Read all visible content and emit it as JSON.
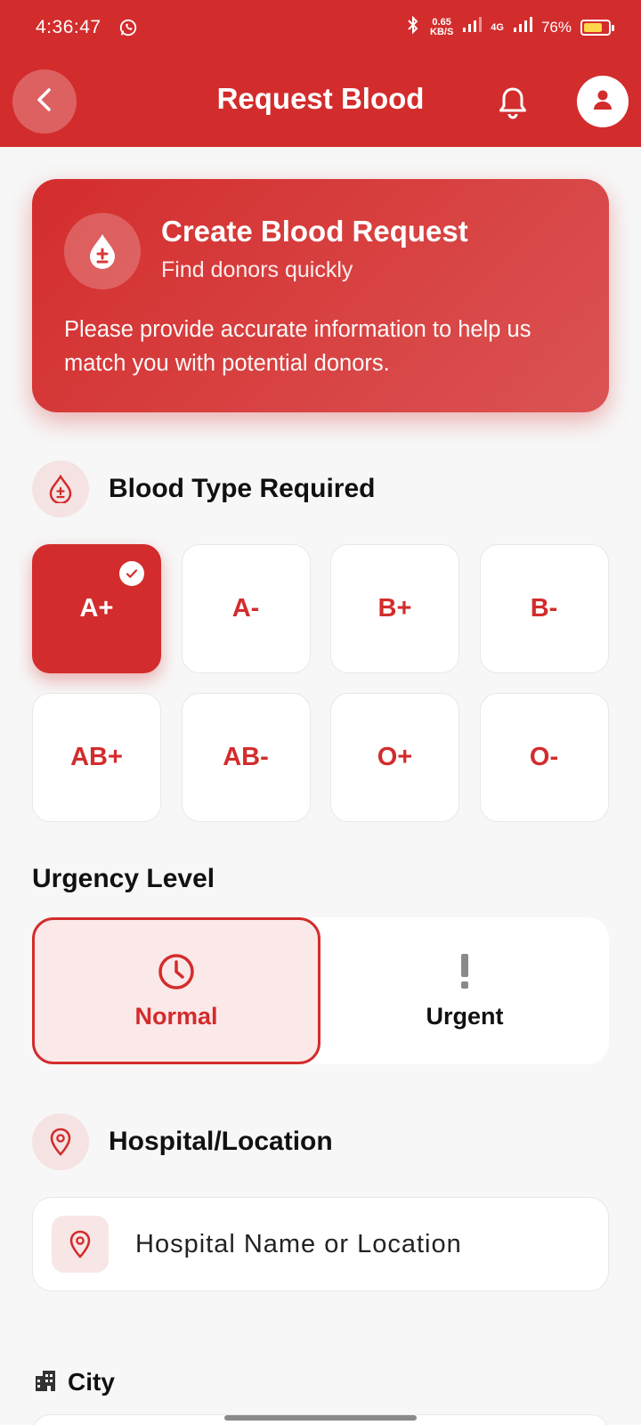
{
  "status_bar": {
    "time": "4:36:47",
    "speed_value": "0.65",
    "speed_unit": "KB/S",
    "network": "4G",
    "battery": "76%"
  },
  "header": {
    "title": "Request Blood"
  },
  "hero": {
    "title": "Create Blood Request",
    "subtitle": "Find donors quickly",
    "description": "Please provide accurate information to help us match you with potential donors."
  },
  "blood_section": {
    "title": "Blood Type Required",
    "types": [
      {
        "label": "A+",
        "selected": true
      },
      {
        "label": "A-",
        "selected": false
      },
      {
        "label": "B+",
        "selected": false
      },
      {
        "label": "B-",
        "selected": false
      },
      {
        "label": "AB+",
        "selected": false
      },
      {
        "label": "AB-",
        "selected": false
      },
      {
        "label": "O+",
        "selected": false
      },
      {
        "label": "O-",
        "selected": false
      }
    ]
  },
  "urgency": {
    "title": "Urgency Level",
    "options": [
      {
        "label": "Normal",
        "selected": true,
        "icon": "clock-icon"
      },
      {
        "label": "Urgent",
        "selected": false,
        "icon": "exclamation-icon"
      }
    ]
  },
  "location": {
    "title": "Hospital/Location",
    "placeholder": "Hospital Name or Location"
  },
  "city": {
    "title": "City"
  },
  "colors": {
    "primary": "#d32c2c",
    "tint": "#fbe8e8"
  }
}
